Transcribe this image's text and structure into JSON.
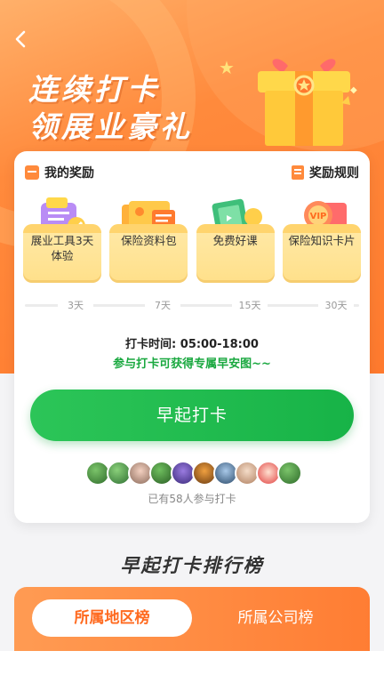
{
  "header": {
    "back_icon": "chevron-left-icon",
    "headline_line1": "连续打卡",
    "headline_line2": "领展业豪礼"
  },
  "card": {
    "my_reward_label": "我的奖励",
    "rule_label": "奖励规则",
    "rewards": [
      {
        "label": "展业工具3天体验",
        "icon": "tool-kit-icon"
      },
      {
        "label": "保险资料包",
        "icon": "document-pack-icon"
      },
      {
        "label": "免费好课",
        "icon": "course-book-icon"
      },
      {
        "label": "保险知识卡片",
        "icon": "vip-card-icon"
      }
    ],
    "days": [
      "3天",
      "7天",
      "15天",
      "30天"
    ],
    "checkin_time": "打卡时间: 05:00-18:00",
    "tip": "参与打卡可获得专属早安图~~",
    "button_label": "早起打卡",
    "joined_text": "已有58人参与打卡"
  },
  "ranking": {
    "title": "早起打卡排行榜",
    "tabs": [
      "所属地区榜",
      "所属公司榜"
    ],
    "active_tab": 0
  },
  "colors": {
    "accent": "#ff7a2e",
    "green": "#19a83f"
  }
}
